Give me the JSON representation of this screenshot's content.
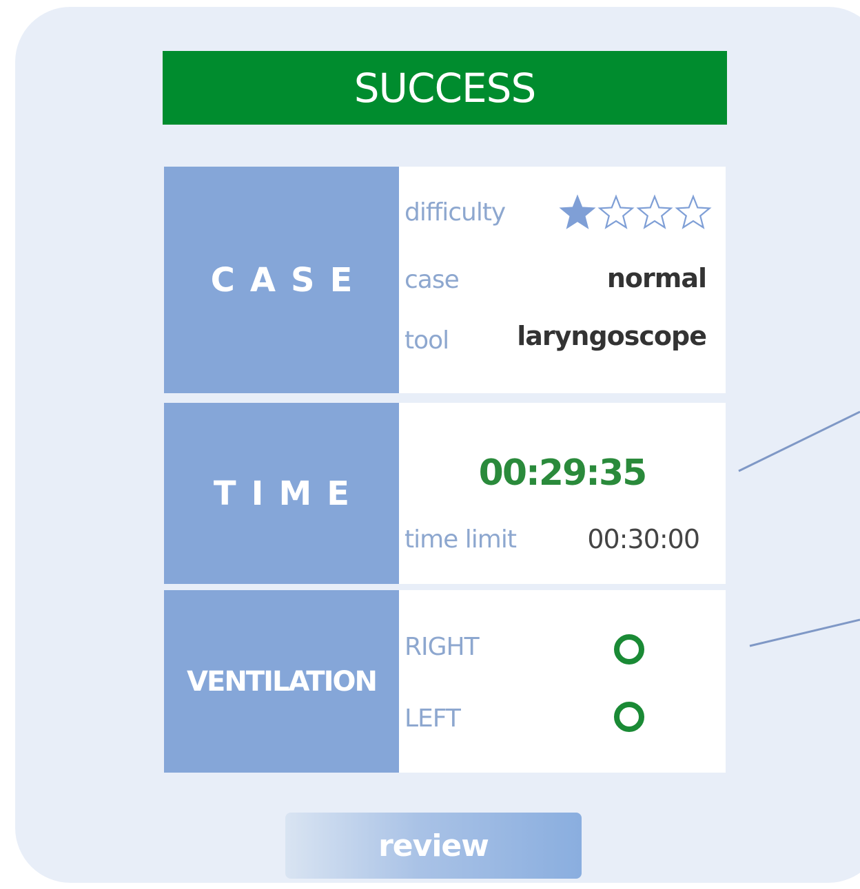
{
  "banner": {
    "title": "SUCCESS"
  },
  "case_section": {
    "label": "CASE",
    "difficulty_label": "difficulty",
    "difficulty_rating": {
      "filled": 1,
      "total": 4
    },
    "case_label": "case",
    "case_value": "normal",
    "tool_label": "tool",
    "tool_value": "laryngoscope"
  },
  "time_section": {
    "label": "TIME",
    "elapsed": "00:29:35",
    "limit_label": "time limit",
    "limit_value": "00:30:00"
  },
  "ventilation_section": {
    "label": "VENTILATION",
    "right_label": "RIGHT",
    "right_status_icon": "circle-ok-icon",
    "left_label": "LEFT",
    "left_status_icon": "circle-ok-icon"
  },
  "review_button": {
    "label": "review"
  },
  "colors": {
    "banner_green": "#008c2e",
    "label_blue": "#85a6d8",
    "time_green": "#2a8a3b",
    "status_green": "#1a8a35",
    "star_blue": "#7f9fd6"
  }
}
